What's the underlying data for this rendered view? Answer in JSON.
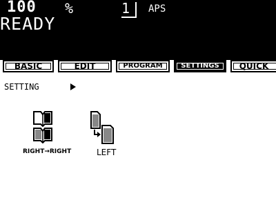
{
  "status": {
    "zoom": "100",
    "percent": "%",
    "copies": "1",
    "paper_mode": "APS",
    "message": "READY"
  },
  "tabs": [
    {
      "label": "BASIC",
      "active": false
    },
    {
      "label": "EDIT",
      "active": false
    },
    {
      "label": "PROGRAM",
      "active": false
    },
    {
      "label": "SETTINGS",
      "active": true
    },
    {
      "label": "QUICK",
      "active": false
    }
  ],
  "breadcrumb": {
    "label": "SETTING",
    "arrow_icon": "triangle-right"
  },
  "options": [
    {
      "label": "RIGHT→RIGHT",
      "icon": "book-duplex-icon"
    },
    {
      "label": "LEFT",
      "icon": "page-rotate-left-icon"
    }
  ],
  "colors": {
    "foreground": "#000000",
    "background": "#ffffff"
  }
}
